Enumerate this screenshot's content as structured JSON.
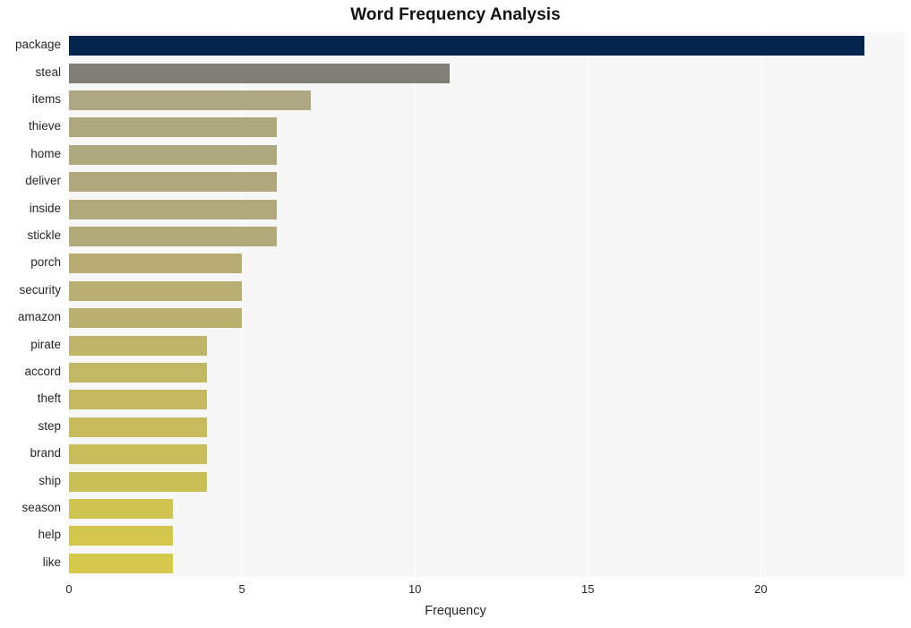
{
  "chart_data": {
    "type": "bar",
    "orientation": "horizontal",
    "title": "Word Frequency Analysis",
    "xlabel": "Frequency",
    "ylabel": "",
    "categories": [
      "package",
      "steal",
      "items",
      "thieve",
      "home",
      "deliver",
      "inside",
      "stickle",
      "porch",
      "security",
      "amazon",
      "pirate",
      "accord",
      "theft",
      "step",
      "brand",
      "ship",
      "season",
      "help",
      "like"
    ],
    "values": [
      23,
      11,
      7,
      6,
      6,
      6,
      6,
      6,
      5,
      5,
      5,
      4,
      4,
      4,
      4,
      4,
      4,
      3,
      3,
      3
    ],
    "bar_colors": [
      "#04244c",
      "#7f7f78",
      "#ada782",
      "#aea87f",
      "#aea87f",
      "#b0a87c",
      "#b1a97b",
      "#b2aa79",
      "#b6ac74",
      "#b8ae71",
      "#bab06e",
      "#c0b566",
      "#c2b763",
      "#c4b960",
      "#c6bb5d",
      "#c8bd5a",
      "#cabf57",
      "#d0c450",
      "#d3c64d",
      "#d6c84a"
    ],
    "xlim": [
      0,
      24.16
    ],
    "xticks": [
      0,
      5,
      10,
      15,
      20
    ],
    "xtick_labels": [
      "0",
      "5",
      "10",
      "15",
      "20"
    ],
    "grid": true,
    "grid_color": "#ffffff",
    "plot_background": "#f7f7f7",
    "figure_background": "#ffffff",
    "legend": "none"
  }
}
